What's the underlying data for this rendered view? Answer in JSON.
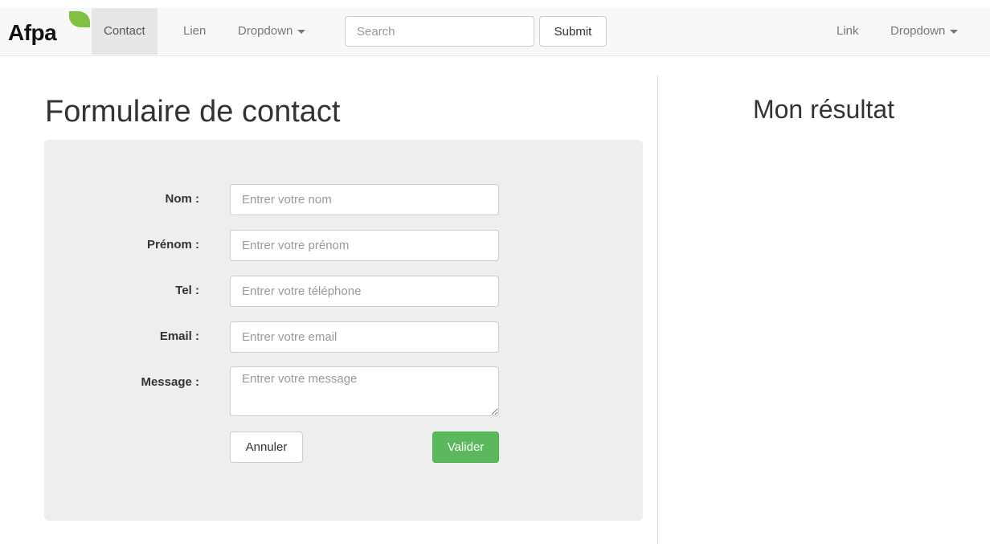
{
  "navbar": {
    "brand": "Afpa",
    "items": [
      {
        "label": "Contact",
        "active": true
      },
      {
        "label": "Lien"
      },
      {
        "label": "Dropdown"
      }
    ],
    "search": {
      "placeholder": "Search",
      "value": ""
    },
    "submit_label": "Submit",
    "right_items": [
      {
        "label": "Link"
      },
      {
        "label": "Dropdown"
      }
    ]
  },
  "form": {
    "title": "Formulaire de contact",
    "fields": [
      {
        "label": "Nom :",
        "placeholder": "Entrer votre nom",
        "value": ""
      },
      {
        "label": "Prénom :",
        "placeholder": "Entrer votre prénom",
        "value": ""
      },
      {
        "label": "Tel :",
        "placeholder": "Entrer votre téléphone",
        "value": ""
      },
      {
        "label": "Email :",
        "placeholder": "Entrer votre email",
        "value": ""
      },
      {
        "label": "Message :",
        "placeholder": "Entrer votre message",
        "value": ""
      }
    ],
    "cancel_label": "Annuler",
    "submit_label": "Valider"
  },
  "result": {
    "title": "Mon résultat"
  },
  "colors": {
    "brand_leaf": "#7fc241",
    "success": "#5cb85c",
    "panel": "#eeeeee",
    "navbar": "#f8f8f8"
  }
}
